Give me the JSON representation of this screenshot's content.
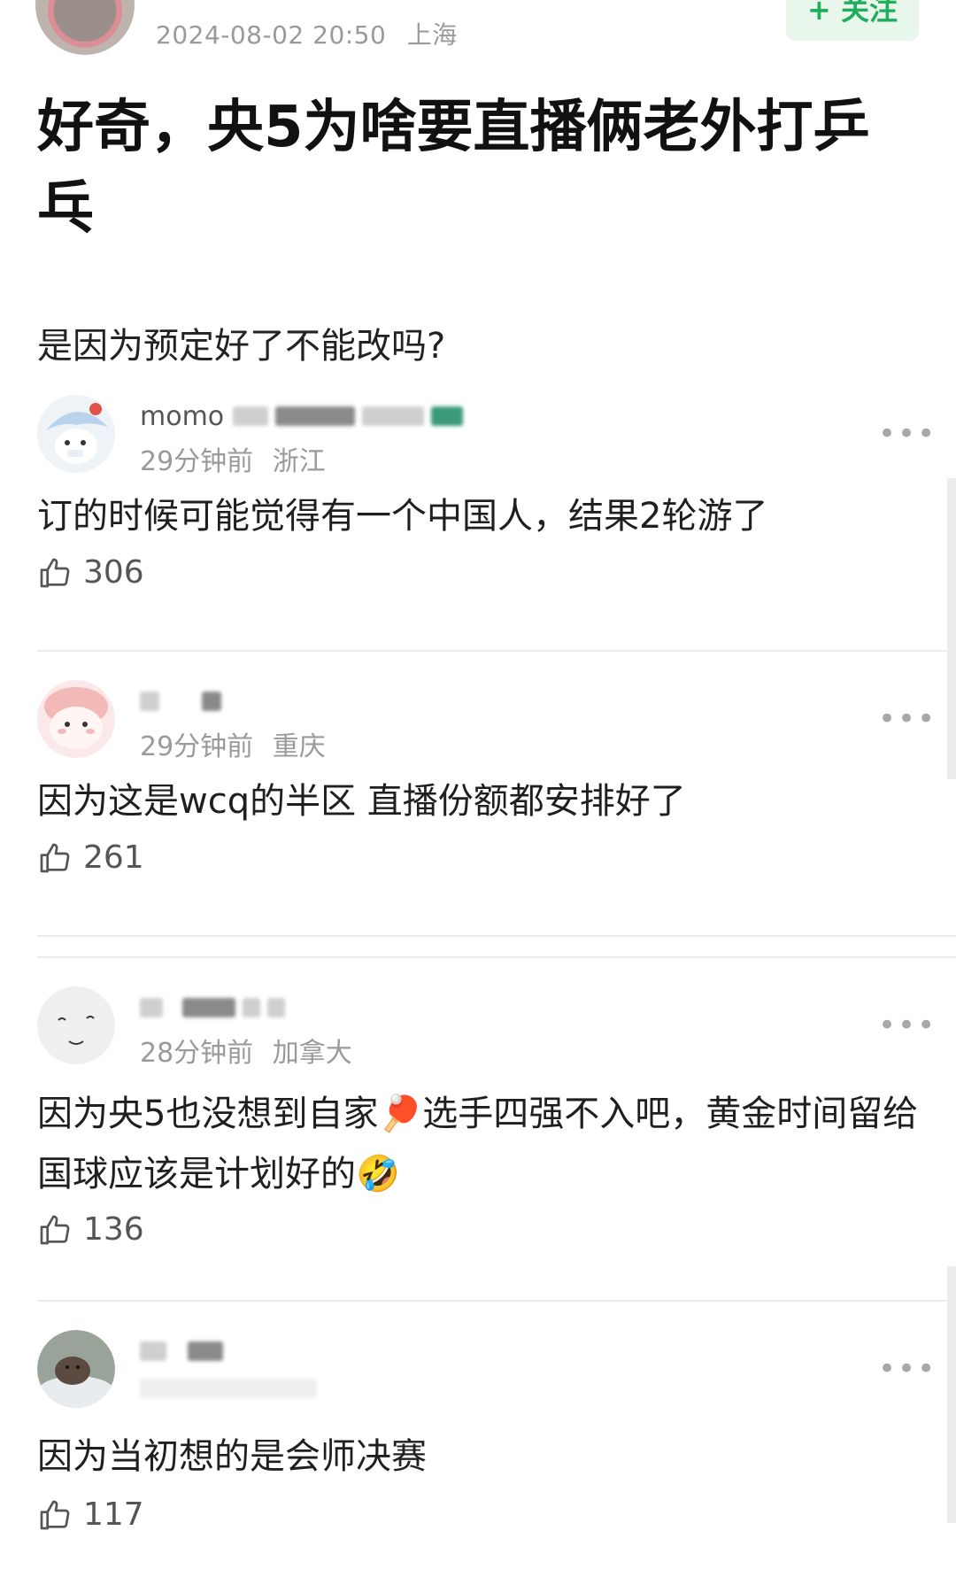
{
  "post": {
    "timestamp": "2024-08-02 20:50",
    "location": "上海",
    "follow_label": "+ 关注",
    "title": "好奇，央5为啥要直播俩老外打乒乓",
    "subtitle": "是因为预定好了不能改吗?"
  },
  "comments": [
    {
      "username": "momo",
      "time": "29分钟前",
      "location": "浙江",
      "text": "订的时候可能觉得有一个中国人，结果2轮游了",
      "likes": "306"
    },
    {
      "username": "",
      "time": "29分钟前",
      "location": "重庆",
      "text": "因为这是wcq的半区 直播份额都安排好了",
      "likes": "261"
    },
    {
      "username": "",
      "time": "28分钟前",
      "location": "加拿大",
      "text": "因为央5也没想到自家🏓选手四强不入吧，黄金时间留给国球应该是计划好的🤣",
      "likes": "136"
    },
    {
      "username": "",
      "time": "",
      "location": "",
      "text": "因为当初想的是会师决赛",
      "likes": "117"
    }
  ],
  "icons": {
    "like": "thumbs-up-icon",
    "more": "more-dots-icon"
  },
  "colors": {
    "follow_green": "#1fae5b",
    "follow_bg": "#e8f6ec",
    "meta_gray": "#9a9a9a"
  }
}
